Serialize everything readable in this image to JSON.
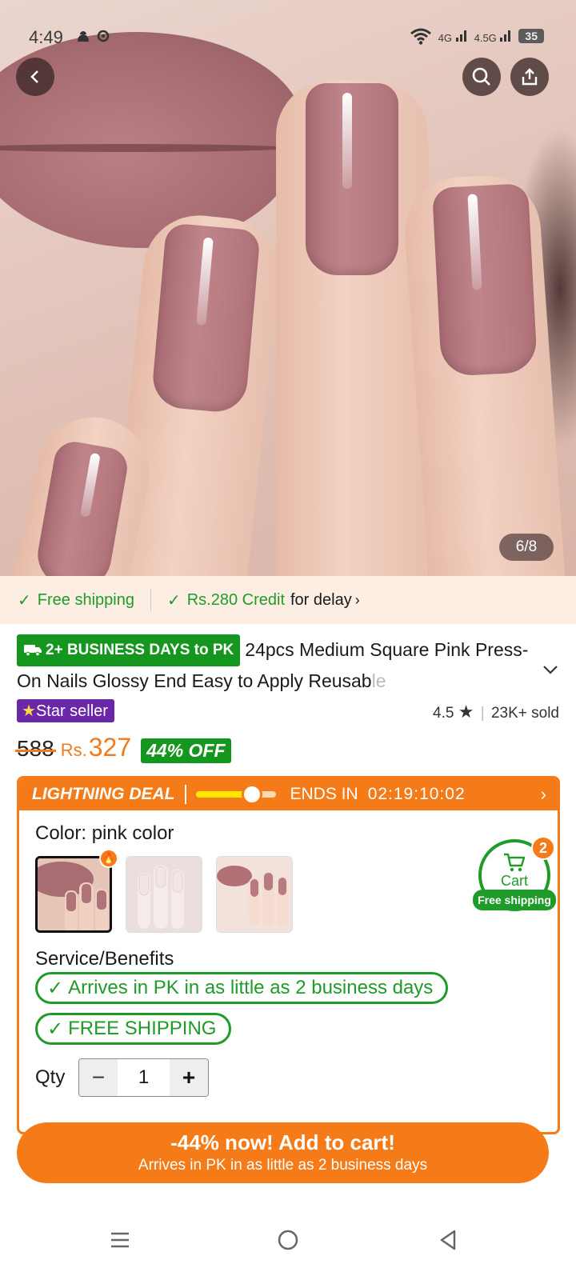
{
  "status_bar": {
    "time": "4:49",
    "network_1": "4G",
    "network_2": "4.5G",
    "battery": "35"
  },
  "hero": {
    "image_counter": "6/8",
    "icons": [
      "back-icon",
      "search-icon",
      "share-icon"
    ]
  },
  "shipping_strip": {
    "free_shipping": "Free shipping",
    "credit_amount": "Rs.280 Credit",
    "credit_suffix": "for delay"
  },
  "product": {
    "delivery_badge": "2+ BUSINESS DAYS to PK",
    "title_main": "24pcs Medium Square Pink Press-On Nails Glossy End Easy to Apply Reusab",
    "title_fade": "le",
    "seller_badge": "Star seller",
    "rating": "4.5",
    "sold": "23K+ sold",
    "old_price": "588",
    "currency": "Rs.",
    "price": "327",
    "discount": "44% OFF"
  },
  "deal": {
    "title": "LIGHTNING DEAL",
    "progress_fraction": 0.7,
    "ends_label": "ENDS IN",
    "countdown": "02:19:10:02"
  },
  "options": {
    "color_label": "Color:",
    "color_value": "pink color",
    "swatches": [
      "pink-nails",
      "nude-nails",
      "mauve-nails"
    ],
    "selected_swatch": 0
  },
  "service": {
    "label": "Service/Benefits",
    "benefit_1": "Arrives in PK in as little as 2 business days",
    "benefit_2": "FREE SHIPPING"
  },
  "qty": {
    "label": "Qty",
    "value": "1",
    "minus": "−",
    "plus": "+"
  },
  "cart": {
    "label": "Cart",
    "badge": "2",
    "free_shipping": "Free shipping"
  },
  "cta": {
    "main": "-44% now! Add to cart!",
    "sub": "Arrives in PK in as little as 2 business days"
  },
  "colors": {
    "accent": "#f47b18",
    "green": "#1e9b28",
    "purple": "#6a27a8"
  }
}
